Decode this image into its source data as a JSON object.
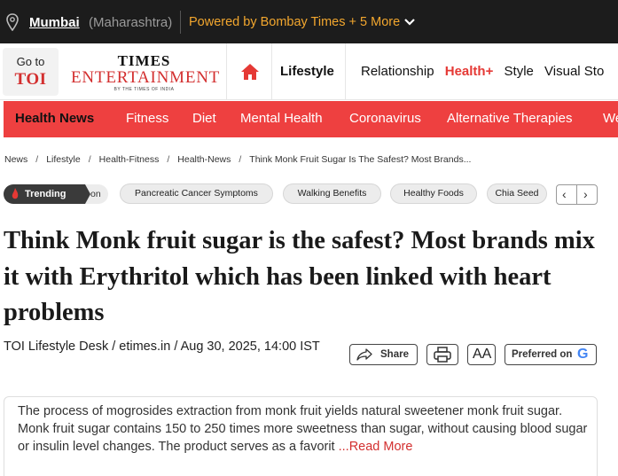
{
  "topbar": {
    "city": "Mumbai",
    "state": "(Maharashtra)",
    "powered": "Powered by Bombay Times + 5 More"
  },
  "header": {
    "goto_label": "Go to",
    "goto_brand": "TOI",
    "logo_line1": "TIMES",
    "logo_line2": "ENTERTAINMENT",
    "logo_sub": "BY THE TIMES OF INDIA",
    "section": "Lifestyle",
    "nav": [
      "Relationship",
      "Health+",
      "Style",
      "Visual Sto"
    ]
  },
  "rednav": {
    "items": [
      "Health News",
      "Fitness",
      "Diet",
      "Mental Health",
      "Coronavirus",
      "Alternative Therapies",
      "We"
    ]
  },
  "breadcrumb": [
    "News",
    "Lifestyle",
    "Health-Fitness",
    "Health-News",
    "Think Monk Fruit Sugar Is The Safest? Most Brands..."
  ],
  "trending": {
    "label": "Trending",
    "chips": [
      "on",
      "Pancreatic Cancer Symptoms",
      "Walking Benefits",
      "Healthy Foods",
      "Chia Seed"
    ]
  },
  "article": {
    "headline": "Think Monk fruit sugar is the safest? Most brands mix it with Erythritol which has been linked with heart problems",
    "byline": "TOI Lifestyle Desk / etimes.in / Aug 30, 2025, 14:00 IST",
    "share_label": "Share",
    "aa_label": "AA",
    "preferred_label": "Preferred on",
    "summary": "The process of mogrosides extraction from monk fruit yields natural sweetener monk fruit sugar. Monk fruit sugar contains 150 to 250 times more sweetness than sugar, without causing blood sugar or insulin level changes. The product serves as a favorit",
    "read_more": "...Read More"
  },
  "colors": {
    "accent_red": "#ee4040",
    "brand_red": "#d32f2f",
    "topbar_bg": "#1c1c1c",
    "powered_orange": "#f3a72e"
  },
  "icons": [
    "location-pin-icon",
    "chevron-down-icon",
    "home-icon",
    "flame-icon",
    "chevron-left-icon",
    "chevron-right-icon",
    "share-icon",
    "print-icon",
    "google-icon"
  ]
}
